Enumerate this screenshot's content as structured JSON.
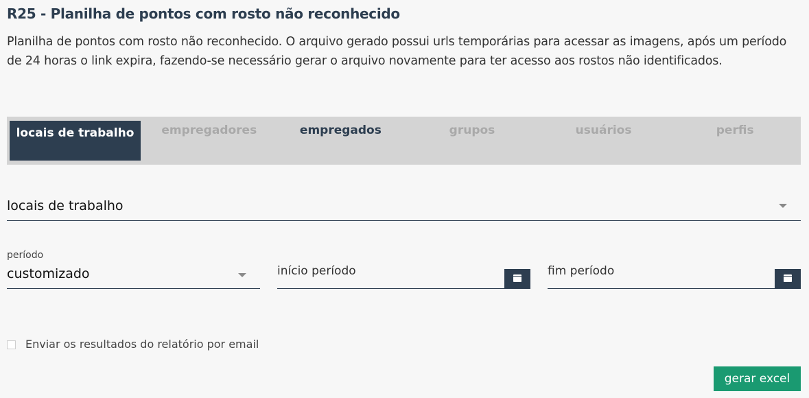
{
  "header": {
    "title": "R25 - Planilha de pontos com rosto não reconhecido",
    "description": "Planilha de pontos com rosto não reconhecido. O arquivo gerado possui urls temporárias para acessar as imagens, após um período de 24 horas o link expira, fazendo-se necessário gerar o arquivo novamente para ter acesso aos rostos não identificados."
  },
  "tabs": [
    {
      "label": "locais de trabalho",
      "state": "active"
    },
    {
      "label": "empregadores",
      "state": "disabled"
    },
    {
      "label": "empregados",
      "state": "enabled"
    },
    {
      "label": "grupos",
      "state": "disabled"
    },
    {
      "label": "usuários",
      "state": "disabled"
    },
    {
      "label": "perfis",
      "state": "disabled"
    }
  ],
  "filter": {
    "selected": "locais de trabalho"
  },
  "period": {
    "label": "período",
    "selected": "customizado",
    "start_placeholder": "início período",
    "end_placeholder": "fim período"
  },
  "email_option": {
    "label": "Enviar os resultados do relatório por email",
    "checked": false
  },
  "actions": {
    "generate_label": "gerar excel"
  },
  "colors": {
    "primary": "#2d3e50",
    "tab_bar": "#d4d4d4",
    "button": "#1a9a71"
  },
  "icons": [
    "caret-down-icon",
    "calendar-icon"
  ]
}
